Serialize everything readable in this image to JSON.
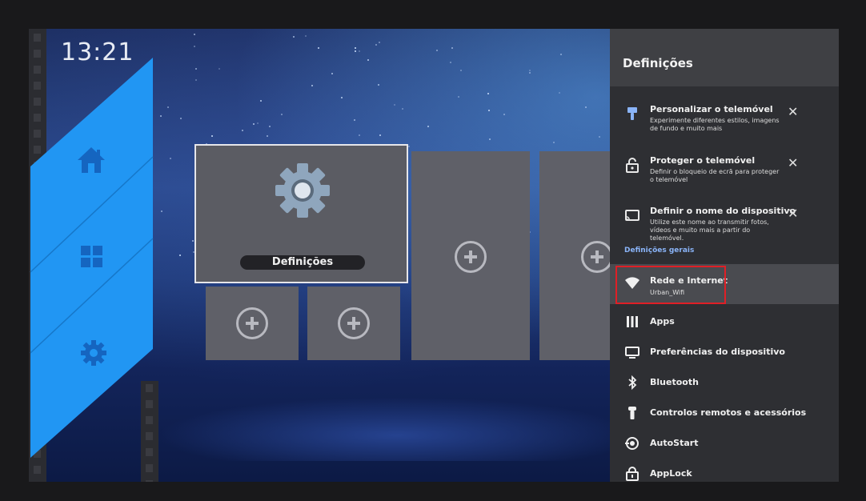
{
  "clock": "13:21",
  "left_nav": {
    "items": [
      {
        "icon": "home-icon"
      },
      {
        "icon": "apps-grid-icon"
      },
      {
        "icon": "gear-icon"
      }
    ]
  },
  "launcher": {
    "main_tile_label": "Definições",
    "main_tile_icon": "gear-icon",
    "add_tile_icon": "plus-circle-icon"
  },
  "settings_panel": {
    "title": "Definições",
    "suggestions": [
      {
        "title": "Personalizar o telemóvel",
        "description": "Experimente diferentes estilos, imagens de fundo e muito mais",
        "icon": "paintbrush-icon",
        "dismiss": "✕"
      },
      {
        "title": "Proteger o telemóvel",
        "description": "Definir o bloqueio de ecrã para proteger o telemóvel",
        "icon": "lock-icon",
        "dismiss": "✕"
      },
      {
        "title": "Definir o nome do dispositivo",
        "description": "Utilize este nome ao transmitir fotos, vídeos e muito mais a partir do telemóvel.",
        "icon": "cast-icon",
        "dismiss": "✕"
      }
    ],
    "section_label": "Definições gerais",
    "highlighted_item": {
      "title": "Rede e Internet",
      "subtitle": "Urban_Wifi",
      "icon": "wifi-icon"
    },
    "items": [
      {
        "title": "Apps",
        "icon": "apps-icon"
      },
      {
        "title": "Preferências do dispositivo",
        "icon": "tv-icon"
      },
      {
        "title": "Bluetooth",
        "icon": "bluetooth-icon"
      },
      {
        "title": "Controlos remotos e acessórios",
        "icon": "remote-icon"
      },
      {
        "title": "AutoStart",
        "icon": "autostart-icon"
      },
      {
        "title": "AppLock",
        "icon": "applock-icon"
      }
    ],
    "highlight_color": "#e01f26",
    "section_color": "#8ab4f8"
  },
  "colors": {
    "nav_blue": "#1e88e5",
    "tile_grey": "#5f6068",
    "panel_bg": "#2e2f33"
  }
}
